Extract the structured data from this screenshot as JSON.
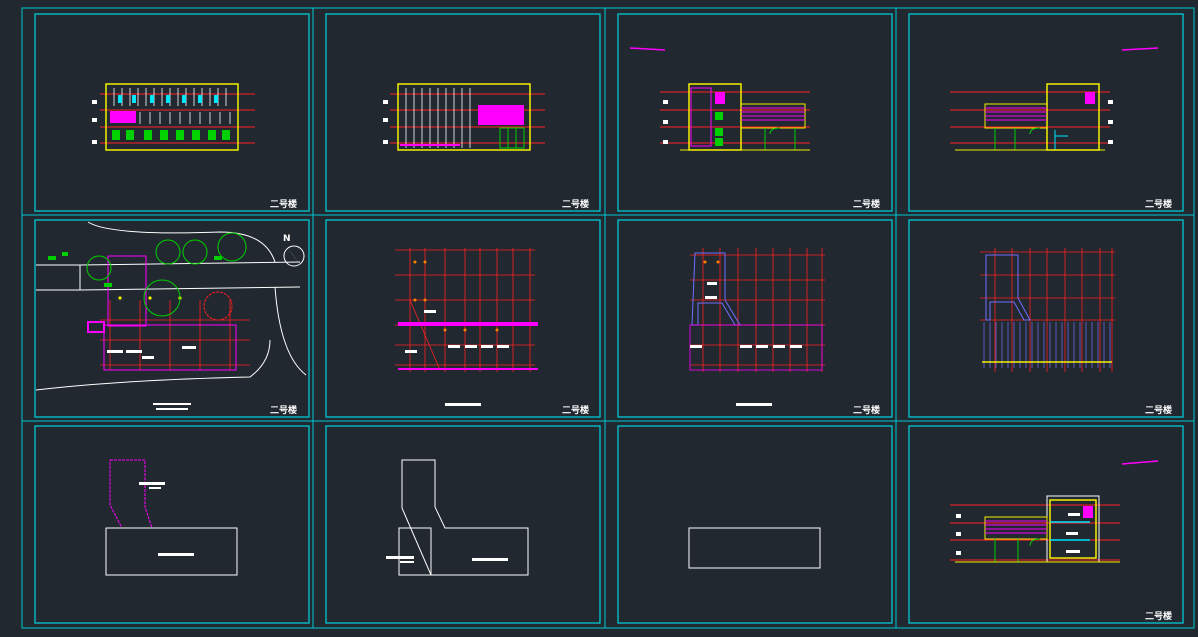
{
  "app": {
    "canvas_background": "#212830",
    "frame_color": "#00c8d2",
    "colors": {
      "red": "#ff2020",
      "yellow": "#f5f000",
      "magenta": "#ff00ff",
      "cyan": "#00e6ff",
      "green": "#00d000",
      "white": "#ffffff",
      "purple": "#7070ff",
      "orange": "#ff8000"
    }
  },
  "sheets": [
    {
      "id": "elevation-front",
      "kind": "elevation",
      "stamp": "二号楼"
    },
    {
      "id": "elevation-rear",
      "kind": "elevation",
      "stamp": "二号楼"
    },
    {
      "id": "elevation-side-left",
      "kind": "side-elevation",
      "stamp": "二号楼"
    },
    {
      "id": "elevation-side-right",
      "kind": "side-elevation",
      "stamp": "二号楼"
    },
    {
      "id": "site-plan",
      "kind": "site-plan",
      "stamp": "二号楼",
      "north_label": "N"
    },
    {
      "id": "floor-plan-1",
      "kind": "floor-plan",
      "stamp": "二号楼"
    },
    {
      "id": "floor-plan-2",
      "kind": "floor-plan",
      "stamp": "二号楼"
    },
    {
      "id": "floor-plan-3",
      "kind": "floor-plan",
      "stamp": "二号楼"
    },
    {
      "id": "roof-plan-1",
      "kind": "outline",
      "stamp": ""
    },
    {
      "id": "roof-plan-2",
      "kind": "outline",
      "stamp": ""
    },
    {
      "id": "roof-plan-3",
      "kind": "outline",
      "stamp": ""
    },
    {
      "id": "section",
      "kind": "section",
      "stamp": "二号楼"
    }
  ]
}
